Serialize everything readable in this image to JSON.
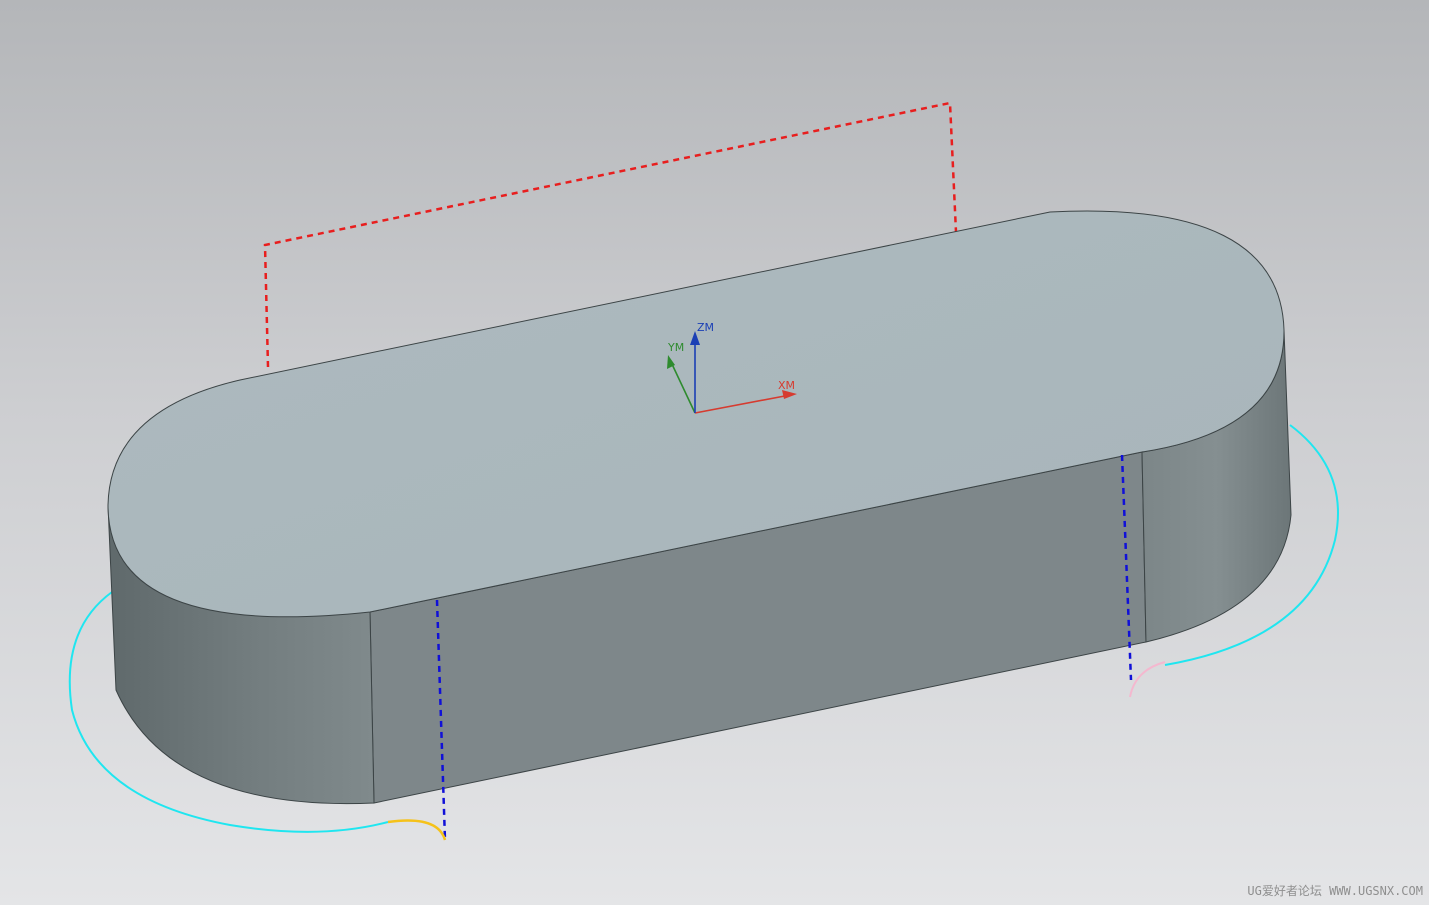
{
  "viewport": {
    "background_top": "#b4b6b9",
    "background_bottom": "#e4e5e7"
  },
  "model": {
    "shape": "rounded slot block",
    "top_face_color": "#abb8bd",
    "side_face_color": "#7f888a",
    "end_face_color": "#6f797b"
  },
  "wcs": {
    "x_label": "XM",
    "y_label": "YM",
    "z_label": "ZM",
    "x_color": "#d63b2f",
    "y_color": "#2e8b2e",
    "z_color": "#1b3fb5"
  },
  "toolpath": {
    "rapid_color": "#e81e1e",
    "feed_color": "#1010d8",
    "cut_color": "#1fe6f0",
    "engage_color": "#f5c21a",
    "retract_color": "#f4b8cf"
  },
  "watermark": {
    "text": "UG爱好者论坛 WWW.UGSNX.COM"
  }
}
